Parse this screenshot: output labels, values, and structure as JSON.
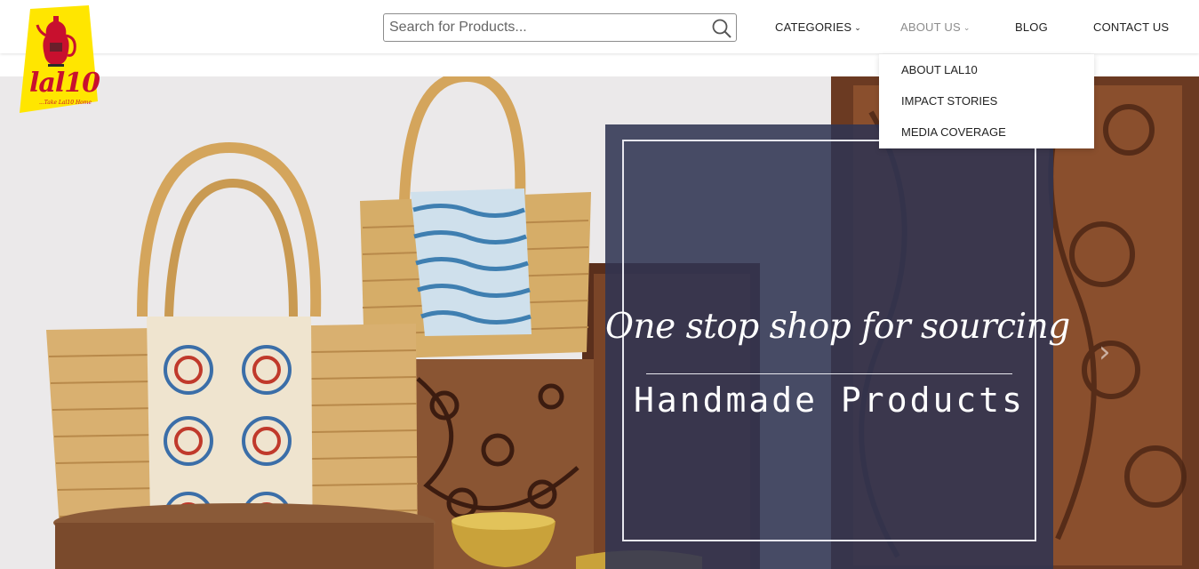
{
  "brand": {
    "logo_text": "lal10",
    "logo_tagline": "...Take Lal10 Home"
  },
  "search": {
    "placeholder": "Search for Products...",
    "value": ""
  },
  "nav": {
    "categories": "CATEGORIES",
    "about": "ABOUT US",
    "blog": "BLOG",
    "contact": "CONTACT US",
    "chevron": "⌄"
  },
  "about_menu": {
    "items": [
      "ABOUT LAL10",
      "IMPACT STORIES",
      "MEDIA COVERAGE"
    ]
  },
  "hero": {
    "tagline": "One stop shop for sourcing",
    "subtitle": "Handmade Products",
    "next_arrow": "›"
  },
  "colors": {
    "logo_bg": "#ffe600",
    "logo_red": "#c8102e",
    "overlay": "#303452",
    "nav_active": "#8c8c8c"
  }
}
